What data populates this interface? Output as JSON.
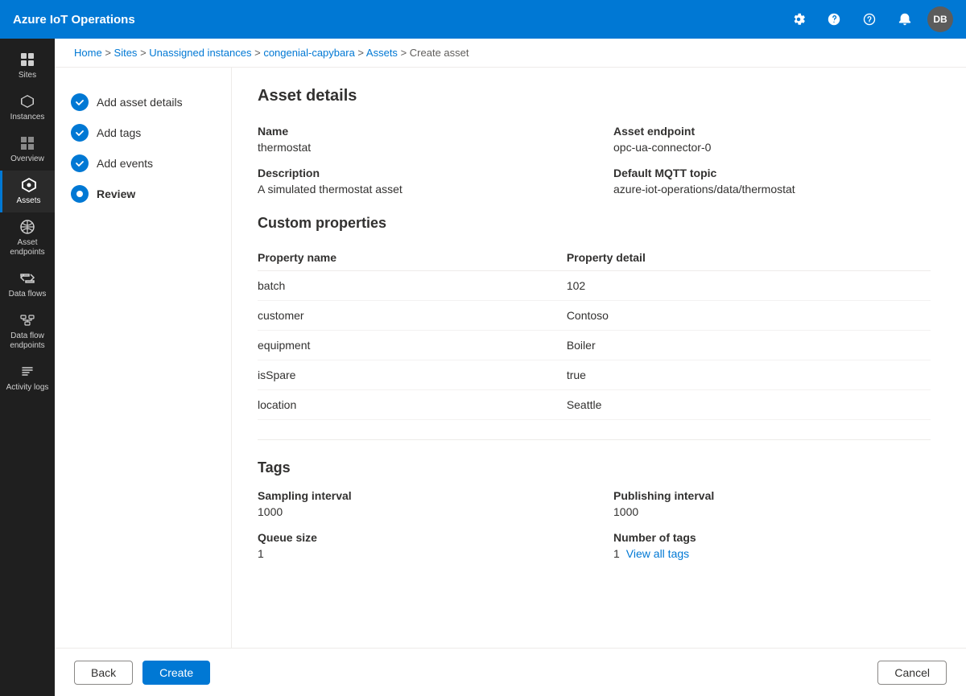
{
  "app": {
    "title": "Azure IoT Operations"
  },
  "topnav": {
    "title": "Azure IoT Operations",
    "icons": {
      "settings": "⚙",
      "help": "?",
      "feedback": "🔔",
      "notifications": "🔔",
      "avatar": "DB"
    }
  },
  "breadcrumb": {
    "items": [
      "Home",
      "Sites",
      "Unassigned instances",
      "congenial-capybara",
      "Assets",
      "Create asset"
    ],
    "separators": [
      ">",
      ">",
      ">",
      ">",
      ">"
    ]
  },
  "steps": [
    {
      "id": "add-asset-details",
      "label": "Add asset details",
      "state": "done"
    },
    {
      "id": "add-tags",
      "label": "Add tags",
      "state": "done"
    },
    {
      "id": "add-events",
      "label": "Add events",
      "state": "done"
    },
    {
      "id": "review",
      "label": "Review",
      "state": "active"
    }
  ],
  "review": {
    "section_title": "Asset details",
    "fields": [
      {
        "label": "Name",
        "value": "thermostat",
        "col": "left"
      },
      {
        "label": "Asset endpoint",
        "value": "opc-ua-connector-0",
        "col": "right"
      },
      {
        "label": "Description",
        "value": "A simulated thermostat asset",
        "col": "left"
      },
      {
        "label": "Default MQTT topic",
        "value": "azure-iot-operations/data/thermostat",
        "col": "right"
      }
    ],
    "custom_properties": {
      "title": "Custom properties",
      "col_headers": [
        "Property name",
        "Property detail"
      ],
      "rows": [
        {
          "name": "batch",
          "detail": "102"
        },
        {
          "name": "customer",
          "detail": "Contoso"
        },
        {
          "name": "equipment",
          "detail": "Boiler"
        },
        {
          "name": "isSpare",
          "detail": "true"
        },
        {
          "name": "location",
          "detail": "Seattle"
        }
      ]
    },
    "tags": {
      "title": "Tags",
      "fields": [
        {
          "label": "Sampling interval",
          "value": "1000",
          "col": "left"
        },
        {
          "label": "Publishing interval",
          "value": "1000",
          "col": "right"
        },
        {
          "label": "Queue size",
          "value": "1",
          "col": "left"
        },
        {
          "label": "Number of tags",
          "value": "1",
          "col": "right"
        }
      ],
      "view_all_label": "View all tags"
    }
  },
  "footer": {
    "back_label": "Back",
    "create_label": "Create",
    "cancel_label": "Cancel"
  },
  "sidebar": {
    "items": [
      {
        "id": "sites",
        "label": "Sites",
        "icon": "⊞"
      },
      {
        "id": "instances",
        "label": "Instances",
        "icon": "⬡"
      },
      {
        "id": "overview",
        "label": "Overview",
        "icon": "▦"
      },
      {
        "id": "assets",
        "label": "Assets",
        "icon": "◈",
        "active": true
      },
      {
        "id": "asset-endpoints",
        "label": "Asset endpoints",
        "icon": "⬡"
      },
      {
        "id": "data-flows",
        "label": "Data flows",
        "icon": "⇌"
      },
      {
        "id": "data-flow-endpoints",
        "label": "Data flow endpoints",
        "icon": "⬡"
      },
      {
        "id": "activity-logs",
        "label": "Activity logs",
        "icon": "≡"
      }
    ]
  }
}
